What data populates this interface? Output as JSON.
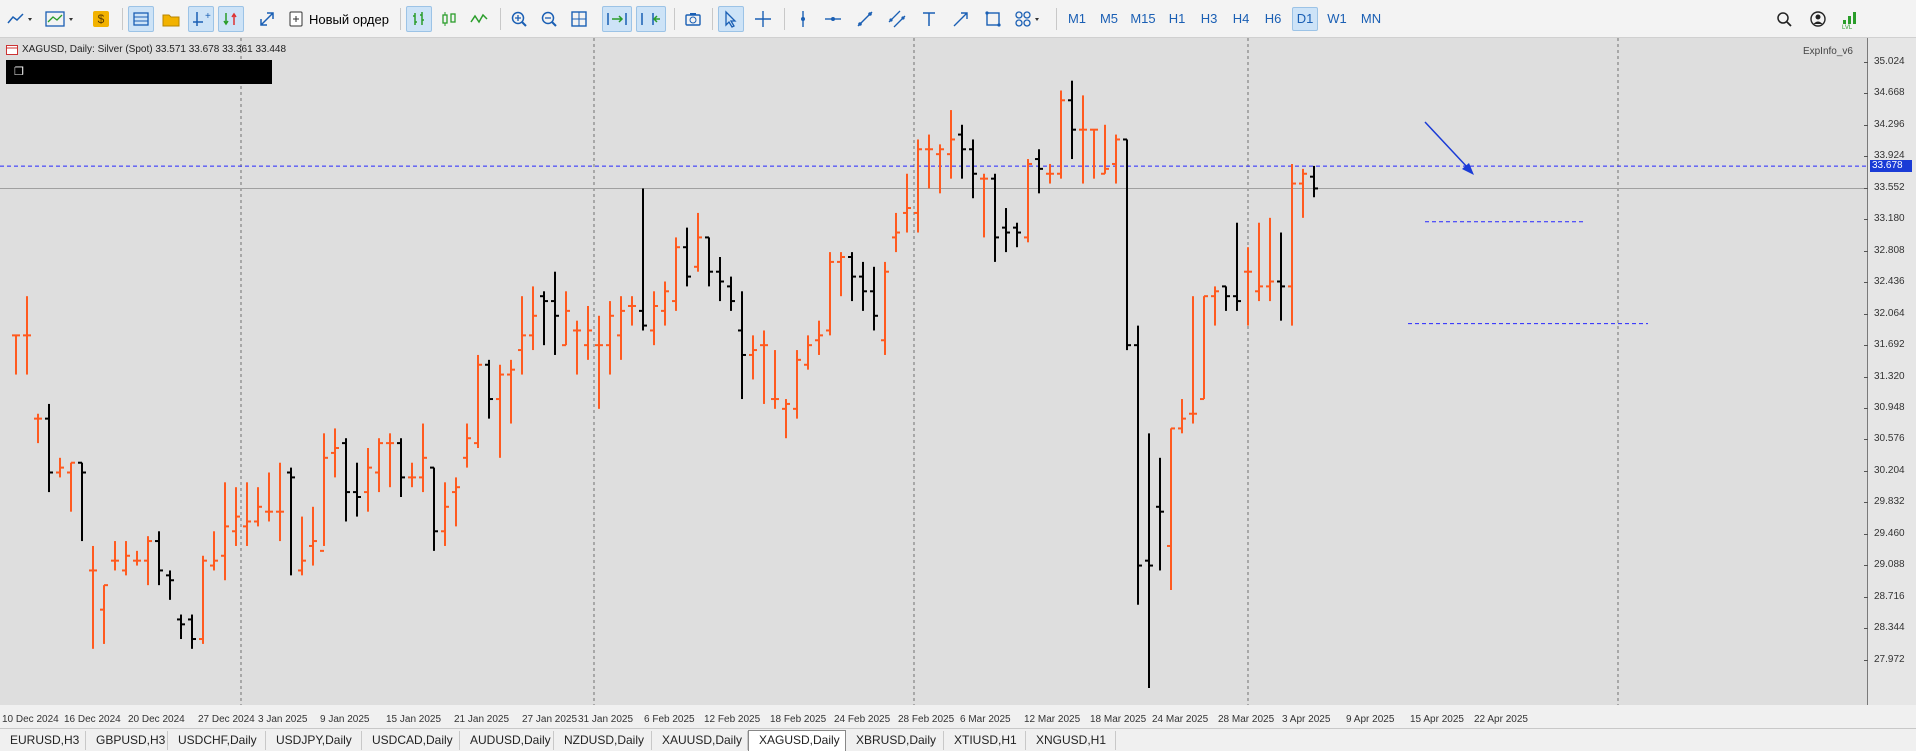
{
  "toolbar": {
    "new_order_label": "Новый ордер",
    "timeframes": [
      {
        "label": "M1",
        "active": false
      },
      {
        "label": "M5",
        "active": false
      },
      {
        "label": "M15",
        "active": false
      },
      {
        "label": "H1",
        "active": false
      },
      {
        "label": "H3",
        "active": false
      },
      {
        "label": "H4",
        "active": false
      },
      {
        "label": "H6",
        "active": false
      },
      {
        "label": "D1",
        "active": true
      },
      {
        "label": "W1",
        "active": false
      },
      {
        "label": "MN",
        "active": false
      }
    ],
    "icons": [
      "line-chart-icon",
      "chart-template-icon",
      "dollar-icon",
      "market-watch-icon",
      "folder-icon",
      "crosshair-add-icon",
      "one-click-trading-icon",
      "fullscreen-icon",
      "new-order-icon",
      "bar-chart-icon",
      "candlestick-icon",
      "line-icon",
      "zoom-in-icon",
      "zoom-out-icon",
      "grid-icon",
      "autoscroll-icon",
      "chart-shift-icon",
      "screenshot-icon",
      "cursor-icon",
      "crosshair-icon",
      "vertical-line-icon",
      "horizontal-line-icon",
      "trendline-icon",
      "channel-icon",
      "text-icon",
      "arrow-icon",
      "rectangle-icon",
      "shapes-icon",
      "search-icon",
      "account-icon",
      "signal-icon"
    ]
  },
  "chart": {
    "header_text": "XAGUSD, Daily:  Silver (Spot)  33.571 33.678 33.361 33.448",
    "black_box_icon": "❐",
    "indicator_label": "ExpInfo_v6",
    "current_price_label": "33.678",
    "price_labels": [
      "35.024",
      "34.668",
      "34.296",
      "33.924",
      "33.552",
      "33.180",
      "32.808",
      "32.436",
      "32.064",
      "31.692",
      "31.320",
      "30.948",
      "30.576",
      "30.204",
      "29.832",
      "29.460",
      "29.088",
      "28.716",
      "28.344",
      "27.972"
    ],
    "date_labels": [
      "10 Dec 2024",
      "16 Dec 2024",
      "20 Dec 2024",
      "27 Dec 2024",
      "3 Jan 2025",
      "9 Jan 2025",
      "15 Jan 2025",
      "21 Jan 2025",
      "27 Jan 2025",
      "31 Jan 2025",
      "6 Feb 2025",
      "12 Feb 2025",
      "18 Feb 2025",
      "24 Feb 2025",
      "28 Feb 2025",
      "6 Mar 2025",
      "12 Mar 2025",
      "18 Mar 2025",
      "24 Mar 2025",
      "28 Mar 2025",
      "3 Apr 2025",
      "9 Apr 2025",
      "15 Apr 2025",
      "22 Apr 2025"
    ],
    "colors": {
      "bull": "#ff5a1f",
      "bear": "#000000",
      "level_line": "#2727ff",
      "grid": "#555555",
      "arrow": "#1a3bd6"
    }
  },
  "chart_data": {
    "type": "ohlc",
    "symbol": "XAGUSD",
    "timeframe": "Daily",
    "ylim": [
      27.8,
      35.2
    ],
    "bars": [
      {
        "o": 31.95,
        "h": 31.95,
        "l": 31.55,
        "c": 31.95
      },
      {
        "o": 31.95,
        "h": 32.35,
        "l": 31.55,
        "c": 31.95
      },
      {
        "o": 31.1,
        "h": 31.15,
        "l": 30.85,
        "c": 31.1
      },
      {
        "o": 31.1,
        "h": 31.25,
        "l": 30.35,
        "c": 30.55
      },
      {
        "o": 30.55,
        "h": 30.7,
        "l": 30.5,
        "c": 30.6
      },
      {
        "o": 30.55,
        "h": 30.65,
        "l": 30.15,
        "c": 30.65
      },
      {
        "o": 30.65,
        "h": 30.65,
        "l": 29.85,
        "c": 30.55
      },
      {
        "o": 29.55,
        "h": 29.8,
        "l": 28.75,
        "c": 29.55
      },
      {
        "o": 29.15,
        "h": 29.4,
        "l": 28.8,
        "c": 29.4
      },
      {
        "o": 29.65,
        "h": 29.85,
        "l": 29.55,
        "c": 29.65
      },
      {
        "o": 29.55,
        "h": 29.85,
        "l": 29.5,
        "c": 29.7
      },
      {
        "o": 29.65,
        "h": 29.75,
        "l": 29.6,
        "c": 29.65
      },
      {
        "o": 29.65,
        "h": 29.9,
        "l": 29.4,
        "c": 29.85
      },
      {
        "o": 29.85,
        "h": 29.95,
        "l": 29.4,
        "c": 29.55
      },
      {
        "o": 29.5,
        "h": 29.55,
        "l": 29.25,
        "c": 29.45
      },
      {
        "o": 29.05,
        "h": 29.1,
        "l": 28.85,
        "c": 29.0
      },
      {
        "o": 29.05,
        "h": 29.1,
        "l": 28.75,
        "c": 28.85
      },
      {
        "o": 28.85,
        "h": 29.7,
        "l": 28.8,
        "c": 29.65
      },
      {
        "o": 29.6,
        "h": 29.95,
        "l": 29.55,
        "c": 29.65
      },
      {
        "o": 29.7,
        "h": 30.45,
        "l": 29.45,
        "c": 30.0
      },
      {
        "o": 29.95,
        "h": 30.4,
        "l": 29.8,
        "c": 30.1
      },
      {
        "o": 30.0,
        "h": 30.45,
        "l": 29.8,
        "c": 30.05
      },
      {
        "o": 30.05,
        "h": 30.4,
        "l": 30.0,
        "c": 30.2
      },
      {
        "o": 30.15,
        "h": 30.55,
        "l": 30.05,
        "c": 30.15
      },
      {
        "o": 30.15,
        "h": 30.65,
        "l": 29.85,
        "c": 30.15
      },
      {
        "o": 30.55,
        "h": 30.6,
        "l": 29.5,
        "c": 30.5
      },
      {
        "o": 29.55,
        "h": 30.1,
        "l": 29.5,
        "c": 29.65
      },
      {
        "o": 29.8,
        "h": 30.2,
        "l": 29.6,
        "c": 29.85
      },
      {
        "o": 29.75,
        "h": 30.95,
        "l": 29.8,
        "c": 30.7
      },
      {
        "o": 30.75,
        "h": 31.0,
        "l": 30.5,
        "c": 30.8
      },
      {
        "o": 30.85,
        "h": 30.9,
        "l": 30.05,
        "c": 30.35
      },
      {
        "o": 30.35,
        "h": 30.65,
        "l": 30.1,
        "c": 30.3
      },
      {
        "o": 30.35,
        "h": 30.8,
        "l": 30.15,
        "c": 30.6
      },
      {
        "o": 30.55,
        "h": 30.9,
        "l": 30.35,
        "c": 30.85
      },
      {
        "o": 30.85,
        "h": 30.95,
        "l": 30.4,
        "c": 30.85
      },
      {
        "o": 30.85,
        "h": 30.9,
        "l": 30.3,
        "c": 30.5
      },
      {
        "o": 30.5,
        "h": 30.65,
        "l": 30.4,
        "c": 30.5
      },
      {
        "o": 30.5,
        "h": 31.05,
        "l": 30.35,
        "c": 30.7
      },
      {
        "o": 30.6,
        "h": 30.6,
        "l": 29.75,
        "c": 29.95
      },
      {
        "o": 29.95,
        "h": 30.45,
        "l": 29.8,
        "c": 30.2
      },
      {
        "o": 30.35,
        "h": 30.5,
        "l": 30.0,
        "c": 30.4
      },
      {
        "o": 30.7,
        "h": 31.05,
        "l": 30.6,
        "c": 30.9
      },
      {
        "o": 30.85,
        "h": 31.75,
        "l": 30.8,
        "c": 31.65
      },
      {
        "o": 31.65,
        "h": 31.7,
        "l": 31.1,
        "c": 31.3
      },
      {
        "o": 31.3,
        "h": 31.65,
        "l": 30.7,
        "c": 31.55
      },
      {
        "o": 31.55,
        "h": 31.7,
        "l": 31.05,
        "c": 31.6
      },
      {
        "o": 31.8,
        "h": 32.35,
        "l": 31.55,
        "c": 31.95
      },
      {
        "o": 31.95,
        "h": 32.45,
        "l": 31.8,
        "c": 32.15
      },
      {
        "o": 32.35,
        "h": 32.4,
        "l": 31.85,
        "c": 32.3
      },
      {
        "o": 32.3,
        "h": 32.6,
        "l": 31.75,
        "c": 32.15
      },
      {
        "o": 31.85,
        "h": 32.4,
        "l": 31.85,
        "c": 32.2
      },
      {
        "o": 32.0,
        "h": 32.1,
        "l": 31.55,
        "c": 32.0
      },
      {
        "o": 31.85,
        "h": 32.25,
        "l": 31.7,
        "c": 32.0
      },
      {
        "o": 31.85,
        "h": 32.15,
        "l": 31.2,
        "c": 31.85
      },
      {
        "o": 31.85,
        "h": 32.3,
        "l": 31.55,
        "c": 32.15
      },
      {
        "o": 31.95,
        "h": 32.35,
        "l": 31.7,
        "c": 32.2
      },
      {
        "o": 32.25,
        "h": 32.35,
        "l": 32.05,
        "c": 32.25
      },
      {
        "o": 32.2,
        "h": 33.45,
        "l": 32.0,
        "c": 32.05
      },
      {
        "o": 32.0,
        "h": 32.4,
        "l": 31.85,
        "c": 32.25
      },
      {
        "o": 32.2,
        "h": 32.5,
        "l": 32.05,
        "c": 32.4
      },
      {
        "o": 32.3,
        "h": 32.95,
        "l": 32.2,
        "c": 32.85
      },
      {
        "o": 32.85,
        "h": 33.05,
        "l": 32.45,
        "c": 32.55
      },
      {
        "o": 32.65,
        "h": 33.2,
        "l": 32.6,
        "c": 32.95
      },
      {
        "o": 32.95,
        "h": 32.95,
        "l": 32.45,
        "c": 32.6
      },
      {
        "o": 32.6,
        "h": 32.75,
        "l": 32.3,
        "c": 32.5
      },
      {
        "o": 32.45,
        "h": 32.55,
        "l": 32.2,
        "c": 32.3
      },
      {
        "o": 32.0,
        "h": 32.4,
        "l": 31.3,
        "c": 31.75
      },
      {
        "o": 31.75,
        "h": 31.95,
        "l": 31.5,
        "c": 31.8
      },
      {
        "o": 31.85,
        "h": 32.0,
        "l": 31.25,
        "c": 31.85
      },
      {
        "o": 31.3,
        "h": 31.8,
        "l": 31.2,
        "c": 31.3
      },
      {
        "o": 31.2,
        "h": 31.3,
        "l": 30.9,
        "c": 31.25
      },
      {
        "o": 31.2,
        "h": 31.8,
        "l": 31.1,
        "c": 31.7
      },
      {
        "o": 31.65,
        "h": 31.95,
        "l": 31.6,
        "c": 31.85
      },
      {
        "o": 31.9,
        "h": 32.1,
        "l": 31.75,
        "c": 31.95
      },
      {
        "o": 32.0,
        "h": 32.8,
        "l": 31.95,
        "c": 32.7
      },
      {
        "o": 32.7,
        "h": 32.8,
        "l": 32.35,
        "c": 32.75
      },
      {
        "o": 32.75,
        "h": 32.8,
        "l": 32.3,
        "c": 32.55
      },
      {
        "o": 32.55,
        "h": 32.7,
        "l": 32.2,
        "c": 32.4
      },
      {
        "o": 32.4,
        "h": 32.65,
        "l": 32.0,
        "c": 32.15
      },
      {
        "o": 31.9,
        "h": 32.7,
        "l": 31.75,
        "c": 32.6
      },
      {
        "o": 32.95,
        "h": 33.2,
        "l": 32.8,
        "c": 33.0
      },
      {
        "o": 33.2,
        "h": 33.6,
        "l": 33.0,
        "c": 33.25
      },
      {
        "o": 33.2,
        "h": 33.95,
        "l": 33.0,
        "c": 33.85
      },
      {
        "o": 33.85,
        "h": 34.0,
        "l": 33.45,
        "c": 33.85
      },
      {
        "o": 33.8,
        "h": 33.9,
        "l": 33.4,
        "c": 33.85
      },
      {
        "o": 33.8,
        "h": 34.25,
        "l": 33.55,
        "c": 33.95
      },
      {
        "o": 34.0,
        "h": 34.1,
        "l": 33.55,
        "c": 33.85
      },
      {
        "o": 33.85,
        "h": 33.95,
        "l": 33.35,
        "c": 33.6
      },
      {
        "o": 33.55,
        "h": 33.6,
        "l": 32.95,
        "c": 33.55
      },
      {
        "o": 33.55,
        "h": 33.6,
        "l": 32.7,
        "c": 32.95
      },
      {
        "o": 33.05,
        "h": 33.25,
        "l": 32.8,
        "c": 33.0
      },
      {
        "o": 33.05,
        "h": 33.1,
        "l": 32.85,
        "c": 33.0
      },
      {
        "o": 32.95,
        "h": 33.75,
        "l": 32.9,
        "c": 33.7
      },
      {
        "o": 33.75,
        "h": 33.85,
        "l": 33.4,
        "c": 33.65
      },
      {
        "o": 33.6,
        "h": 33.7,
        "l": 33.5,
        "c": 33.6
      },
      {
        "o": 33.6,
        "h": 34.45,
        "l": 33.55,
        "c": 34.35
      },
      {
        "o": 34.35,
        "h": 34.55,
        "l": 33.75,
        "c": 34.05
      },
      {
        "o": 34.05,
        "h": 34.4,
        "l": 33.5,
        "c": 34.05
      },
      {
        "o": 34.05,
        "h": 34.05,
        "l": 33.55,
        "c": 34.05
      },
      {
        "o": 33.6,
        "h": 34.1,
        "l": 33.6,
        "c": 33.65
      },
      {
        "o": 33.7,
        "h": 34.0,
        "l": 33.5,
        "c": 33.95
      },
      {
        "o": 33.95,
        "h": 33.95,
        "l": 31.8,
        "c": 31.85
      },
      {
        "o": 31.85,
        "h": 32.05,
        "l": 29.2,
        "c": 29.6
      },
      {
        "o": 29.65,
        "h": 30.95,
        "l": 28.35,
        "c": 29.6
      },
      {
        "o": 30.2,
        "h": 30.7,
        "l": 29.55,
        "c": 30.15
      },
      {
        "o": 29.8,
        "h": 31.0,
        "l": 29.35,
        "c": 31.0
      },
      {
        "o": 31.0,
        "h": 31.3,
        "l": 30.95,
        "c": 31.1
      },
      {
        "o": 31.15,
        "h": 32.35,
        "l": 31.05,
        "c": 31.15
      },
      {
        "o": 31.3,
        "h": 32.35,
        "l": 31.3,
        "c": 32.35
      },
      {
        "o": 32.35,
        "h": 32.45,
        "l": 32.05,
        "c": 32.4
      },
      {
        "o": 32.45,
        "h": 32.45,
        "l": 32.2,
        "c": 32.35
      },
      {
        "o": 32.35,
        "h": 33.1,
        "l": 32.2,
        "c": 32.3
      },
      {
        "o": 32.6,
        "h": 32.85,
        "l": 32.05,
        "c": 32.6
      },
      {
        "o": 32.4,
        "h": 33.1,
        "l": 32.3,
        "c": 32.45
      },
      {
        "o": 32.45,
        "h": 33.15,
        "l": 32.3,
        "c": 32.5
      },
      {
        "o": 32.5,
        "h": 33.0,
        "l": 32.1,
        "c": 32.45
      },
      {
        "o": 32.45,
        "h": 33.7,
        "l": 32.05,
        "c": 33.5
      },
      {
        "o": 33.5,
        "h": 33.65,
        "l": 33.15,
        "c": 33.6
      },
      {
        "o": 33.57,
        "h": 33.68,
        "l": 33.36,
        "c": 33.45
      }
    ],
    "levels": [
      33.678,
      33.11,
      32.07
    ]
  },
  "tabs": [
    {
      "label": "EURUSD,H3",
      "active": false
    },
    {
      "label": "GBPUSD,H3",
      "active": false
    },
    {
      "label": "USDCHF,Daily",
      "active": false
    },
    {
      "label": "USDJPY,Daily",
      "active": false
    },
    {
      "label": "USDCAD,Daily",
      "active": false
    },
    {
      "label": "AUDUSD,Daily",
      "active": false
    },
    {
      "label": "NZDUSD,Daily",
      "active": false
    },
    {
      "label": "XAUUSD,Daily",
      "active": false
    },
    {
      "label": "XAGUSD,Daily",
      "active": true
    },
    {
      "label": "XBRUSD,Daily",
      "active": false
    },
    {
      "label": "XTIUSD,H1",
      "active": false
    },
    {
      "label": "XNGUSD,H1",
      "active": false
    }
  ]
}
